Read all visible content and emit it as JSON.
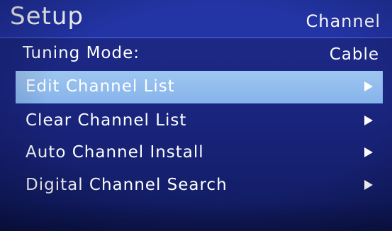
{
  "header": {
    "title": "Setup",
    "section": "Channel"
  },
  "tuning_mode": {
    "label": "Tuning Mode:",
    "value": "Cable"
  },
  "menu": {
    "items": [
      {
        "label": "Edit Channel List",
        "icon": "arrow-right-icon",
        "selected": true
      },
      {
        "label": "Clear Channel List",
        "icon": "arrow-right-icon",
        "selected": false
      },
      {
        "label": "Auto Channel Install",
        "icon": "arrow-right-icon",
        "selected": false
      },
      {
        "label": "Digital Channel Search",
        "icon": "arrow-right-icon",
        "selected": false
      }
    ]
  },
  "colors": {
    "background": "#1b2682",
    "header": "#2334a4",
    "selection": "#8db9ec",
    "text": "#ffffff"
  }
}
